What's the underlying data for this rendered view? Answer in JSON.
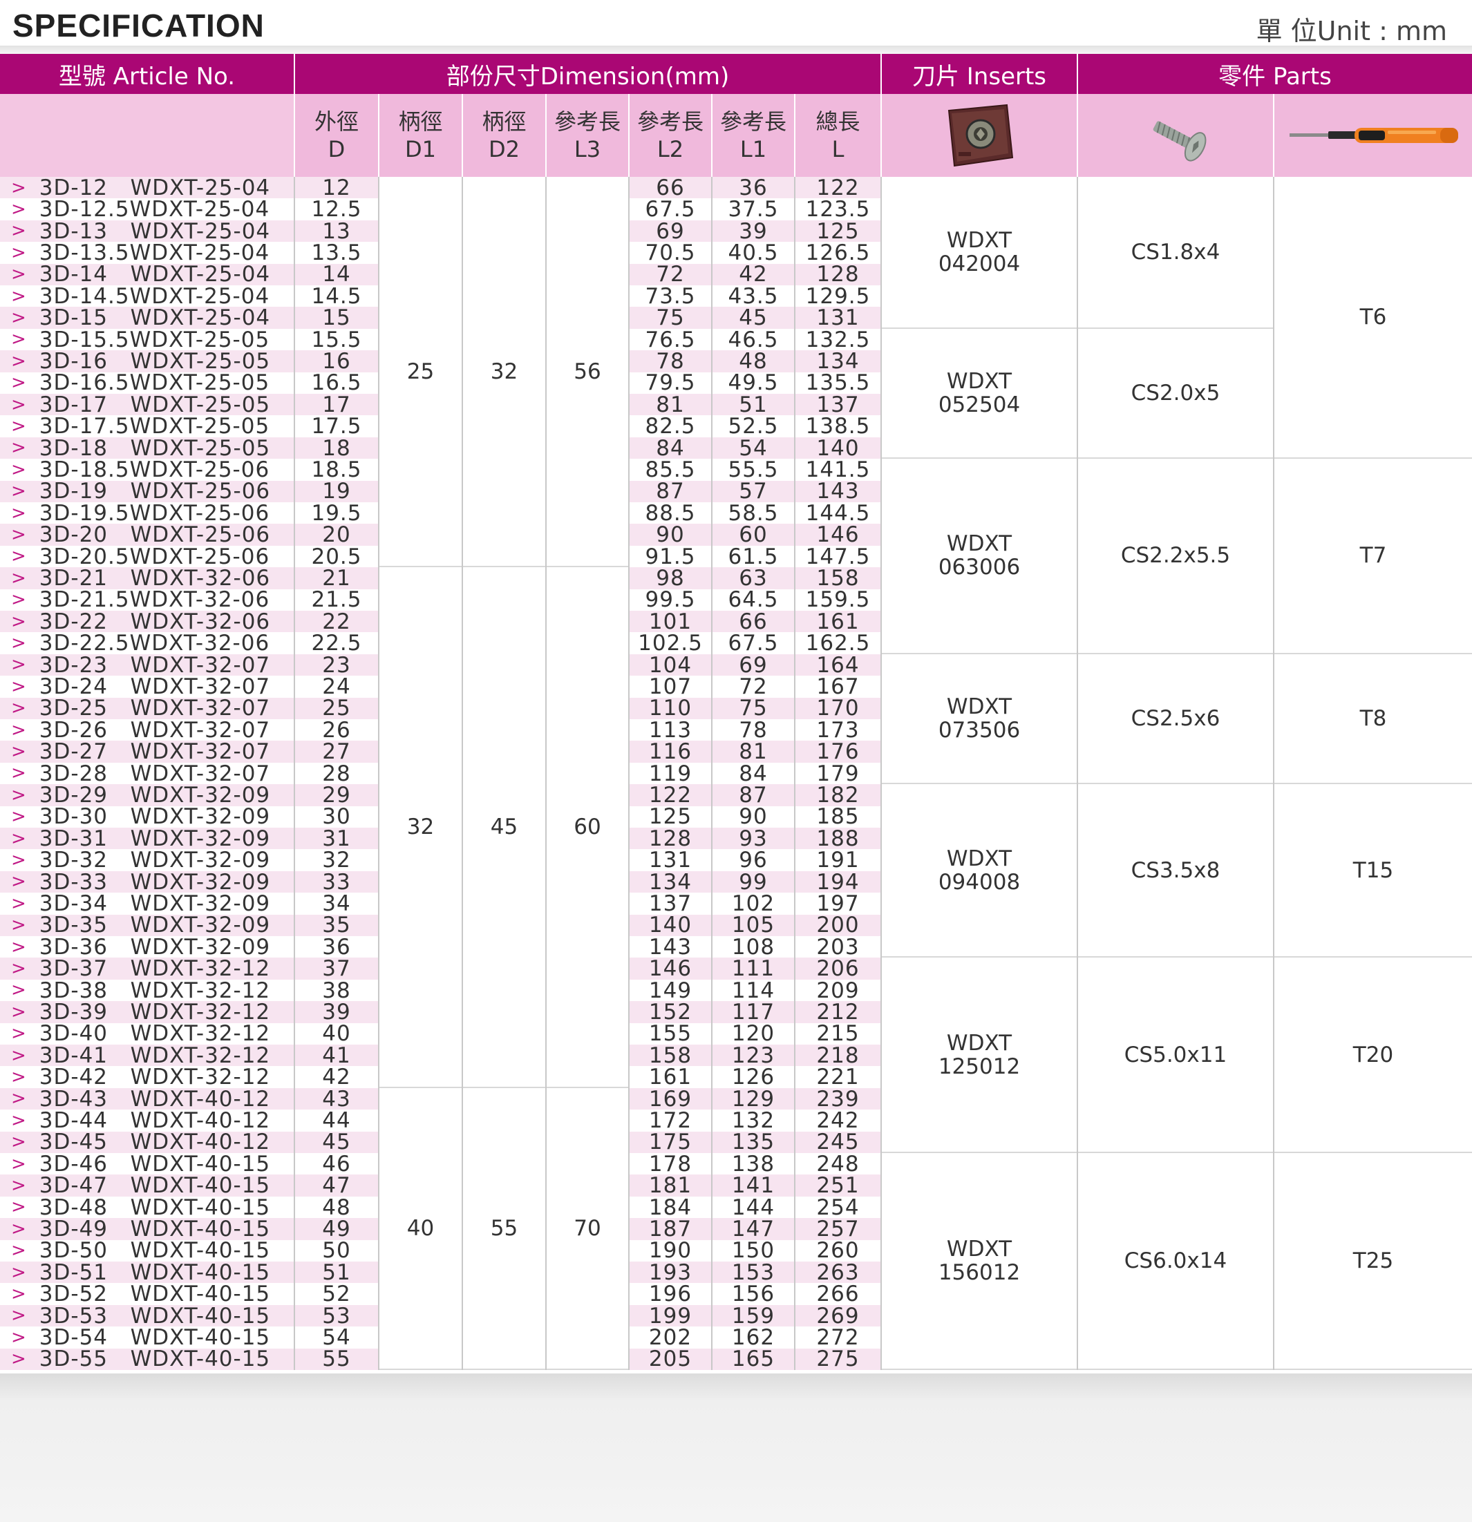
{
  "title": "SPECIFICATION",
  "unit": "單 位Unit : mm",
  "headers": {
    "article": "型號  Article No.",
    "dimension": "部份尺寸Dimension(mm)",
    "inserts": "刀片  Inserts",
    "parts": "零件  Parts"
  },
  "subheaders": [
    {
      "zh": "外徑",
      "en": "D"
    },
    {
      "zh": "柄徑",
      "en": "D1"
    },
    {
      "zh": "柄徑",
      "en": "D2"
    },
    {
      "zh": "參考長",
      "en": "L3"
    },
    {
      "zh": "參考長",
      "en": "L2"
    },
    {
      "zh": "參考長",
      "en": "L1"
    },
    {
      "zh": "總長",
      "en": "L"
    }
  ],
  "icons": {
    "insert": "insert-icon",
    "screw": "screw-icon",
    "driver": "torx-driver-icon"
  },
  "colors": {
    "header": "#aa0774",
    "subheader": "#f0b9dc",
    "stripe": "#f7e4f0",
    "arrow": "#c01a86"
  },
  "rows": [
    [
      "3D-12   WDXT-25-04",
      "12",
      "66",
      "36",
      "122"
    ],
    [
      "3D-12.5WDXT-25-04",
      "12.5",
      "67.5",
      "37.5",
      "123.5"
    ],
    [
      "3D-13   WDXT-25-04",
      "13",
      "69",
      "39",
      "125"
    ],
    [
      "3D-13.5WDXT-25-04",
      "13.5",
      "70.5",
      "40.5",
      "126.5"
    ],
    [
      "3D-14   WDXT-25-04",
      "14",
      "72",
      "42",
      "128"
    ],
    [
      "3D-14.5WDXT-25-04",
      "14.5",
      "73.5",
      "43.5",
      "129.5"
    ],
    [
      "3D-15   WDXT-25-04",
      "15",
      "75",
      "45",
      "131"
    ],
    [
      "3D-15.5WDXT-25-05",
      "15.5",
      "76.5",
      "46.5",
      "132.5"
    ],
    [
      "3D-16   WDXT-25-05",
      "16",
      "78",
      "48",
      "134"
    ],
    [
      "3D-16.5WDXT-25-05",
      "16.5",
      "79.5",
      "49.5",
      "135.5"
    ],
    [
      "3D-17   WDXT-25-05",
      "17",
      "81",
      "51",
      "137"
    ],
    [
      "3D-17.5WDXT-25-05",
      "17.5",
      "82.5",
      "52.5",
      "138.5"
    ],
    [
      "3D-18   WDXT-25-05",
      "18",
      "84",
      "54",
      "140"
    ],
    [
      "3D-18.5WDXT-25-06",
      "18.5",
      "85.5",
      "55.5",
      "141.5"
    ],
    [
      "3D-19   WDXT-25-06",
      "19",
      "87",
      "57",
      "143"
    ],
    [
      "3D-19.5WDXT-25-06",
      "19.5",
      "88.5",
      "58.5",
      "144.5"
    ],
    [
      "3D-20   WDXT-25-06",
      "20",
      "90",
      "60",
      "146"
    ],
    [
      "3D-20.5WDXT-25-06",
      "20.5",
      "91.5",
      "61.5",
      "147.5"
    ],
    [
      "3D-21   WDXT-32-06",
      "21",
      "98",
      "63",
      "158"
    ],
    [
      "3D-21.5WDXT-32-06",
      "21.5",
      "99.5",
      "64.5",
      "159.5"
    ],
    [
      "3D-22   WDXT-32-06",
      "22",
      "101",
      "66",
      "161"
    ],
    [
      "3D-22.5WDXT-32-06",
      "22.5",
      "102.5",
      "67.5",
      "162.5"
    ],
    [
      "3D-23   WDXT-32-07",
      "23",
      "104",
      "69",
      "164"
    ],
    [
      "3D-24   WDXT-32-07",
      "24",
      "107",
      "72",
      "167"
    ],
    [
      "3D-25   WDXT-32-07",
      "25",
      "110",
      "75",
      "170"
    ],
    [
      "3D-26   WDXT-32-07",
      "26",
      "113",
      "78",
      "173"
    ],
    [
      "3D-27   WDXT-32-07",
      "27",
      "116",
      "81",
      "176"
    ],
    [
      "3D-28   WDXT-32-07",
      "28",
      "119",
      "84",
      "179"
    ],
    [
      "3D-29   WDXT-32-09",
      "29",
      "122",
      "87",
      "182"
    ],
    [
      "3D-30   WDXT-32-09",
      "30",
      "125",
      "90",
      "185"
    ],
    [
      "3D-31   WDXT-32-09",
      "31",
      "128",
      "93",
      "188"
    ],
    [
      "3D-32   WDXT-32-09",
      "32",
      "131",
      "96",
      "191"
    ],
    [
      "3D-33   WDXT-32-09",
      "33",
      "134",
      "99",
      "194"
    ],
    [
      "3D-34   WDXT-32-09",
      "34",
      "137",
      "102",
      "197"
    ],
    [
      "3D-35   WDXT-32-09",
      "35",
      "140",
      "105",
      "200"
    ],
    [
      "3D-36   WDXT-32-09",
      "36",
      "143",
      "108",
      "203"
    ],
    [
      "3D-37   WDXT-32-12",
      "37",
      "146",
      "111",
      "206"
    ],
    [
      "3D-38   WDXT-32-12",
      "38",
      "149",
      "114",
      "209"
    ],
    [
      "3D-39   WDXT-32-12",
      "39",
      "152",
      "117",
      "212"
    ],
    [
      "3D-40   WDXT-32-12",
      "40",
      "155",
      "120",
      "215"
    ],
    [
      "3D-41   WDXT-32-12",
      "41",
      "158",
      "123",
      "218"
    ],
    [
      "3D-42   WDXT-32-12",
      "42",
      "161",
      "126",
      "221"
    ],
    [
      "3D-43   WDXT-40-12",
      "43",
      "169",
      "129",
      "239"
    ],
    [
      "3D-44   WDXT-40-12",
      "44",
      "172",
      "132",
      "242"
    ],
    [
      "3D-45   WDXT-40-12",
      "45",
      "175",
      "135",
      "245"
    ],
    [
      "3D-46   WDXT-40-15",
      "46",
      "178",
      "138",
      "248"
    ],
    [
      "3D-47   WDXT-40-15",
      "47",
      "181",
      "141",
      "251"
    ],
    [
      "3D-48   WDXT-40-15",
      "48",
      "184",
      "144",
      "254"
    ],
    [
      "3D-49   WDXT-40-15",
      "49",
      "187",
      "147",
      "257"
    ],
    [
      "3D-50   WDXT-40-15",
      "50",
      "190",
      "150",
      "260"
    ],
    [
      "3D-51   WDXT-40-15",
      "51",
      "193",
      "153",
      "263"
    ],
    [
      "3D-52   WDXT-40-15",
      "52",
      "196",
      "156",
      "266"
    ],
    [
      "3D-53   WDXT-40-15",
      "53",
      "199",
      "159",
      "269"
    ],
    [
      "3D-54   WDXT-40-15",
      "54",
      "202",
      "162",
      "272"
    ],
    [
      "3D-55   WDXT-40-15",
      "55",
      "205",
      "165",
      "275"
    ]
  ],
  "shank_groups": [
    {
      "from": 0,
      "to": 17,
      "D1": "25",
      "D2": "32",
      "L3": "56"
    },
    {
      "from": 18,
      "to": 41,
      "D1": "32",
      "D2": "45",
      "L3": "60"
    },
    {
      "from": 42,
      "to": 54,
      "D1": "40",
      "D2": "55",
      "L3": "70"
    }
  ],
  "insert_groups": [
    {
      "from": 0,
      "to": 6,
      "insert": [
        "WDXT",
        "042004"
      ],
      "screw": "CS1.8x4"
    },
    {
      "from": 7,
      "to": 12,
      "insert": [
        "WDXT",
        "052504"
      ],
      "screw": "CS2.0x5"
    },
    {
      "from": 13,
      "to": 21,
      "insert": [
        "WDXT",
        "063006"
      ],
      "screw": "CS2.2x5.5"
    },
    {
      "from": 22,
      "to": 27,
      "insert": [
        "WDXT",
        "073506"
      ],
      "screw": "CS2.5x6"
    },
    {
      "from": 28,
      "to": 35,
      "insert": [
        "WDXT",
        "094008"
      ],
      "screw": "CS3.5x8"
    },
    {
      "from": 36,
      "to": 44,
      "insert": [
        "WDXT",
        "125012"
      ],
      "screw": "CS5.0x11"
    },
    {
      "from": 45,
      "to": 54,
      "insert": [
        "WDXT",
        "156012"
      ],
      "screw": "CS6.0x14"
    }
  ],
  "driver_groups": [
    {
      "from": 0,
      "to": 12,
      "driver": "T6"
    },
    {
      "from": 13,
      "to": 21,
      "driver": "T7"
    },
    {
      "from": 22,
      "to": 27,
      "driver": "T8"
    },
    {
      "from": 28,
      "to": 35,
      "driver": "T15"
    },
    {
      "from": 36,
      "to": 44,
      "driver": "T20"
    },
    {
      "from": 45,
      "to": 54,
      "driver": "T25"
    }
  ]
}
